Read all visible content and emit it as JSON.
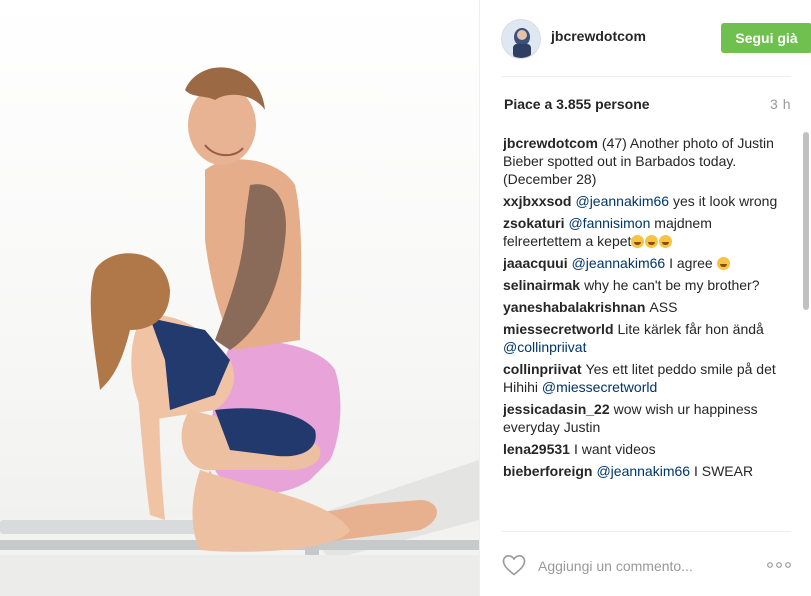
{
  "post": {
    "username": "jbcrewdotcom",
    "follow_label": "Segui già",
    "likes": "Piace a 3.855 persone",
    "time": "3 h",
    "comment_placeholder": "Aggiungi un commento...",
    "follow_color": "#70c050",
    "mention_color": "#003569"
  },
  "comments": [
    {
      "user": "jbcrewdotcom",
      "text": "(47) Another photo of Justin Bieber spotted out in Barbados today. (December 28)"
    },
    {
      "user": "xxjbxxsod",
      "mention": "@jeannakim66",
      "text": "yes it look wrong"
    },
    {
      "user": "zsokaturi",
      "mention": "@fannisimon",
      "text": "majdnem felreertettem a kepet",
      "emoji_count": 3
    },
    {
      "user": "jaaacquui",
      "mention": "@jeannakim66",
      "text": "I agree",
      "emoji_count": 1
    },
    {
      "user": "selinairmak",
      "text": "why he can't be my brother?"
    },
    {
      "user": "yaneshabalakrishnan",
      "text": "ASS"
    },
    {
      "user": "miessecretworld",
      "text": "Lite kärlek får hon ändå",
      "mention_after": "@collinpriivat"
    },
    {
      "user": "collinpriivat",
      "text": "Yes ett litet peddo smile på det Hihihi",
      "mention_after": "@miessecretworld"
    },
    {
      "user": "jessicadasin_22",
      "text": "wow wish ur happiness everyday Justin"
    },
    {
      "user": "lena29531",
      "text": "I want videos"
    },
    {
      "user": "bieberforeign",
      "mention": "@jeannakim66",
      "text": "I SWEAR"
    }
  ],
  "icons": {
    "like": "heart-icon",
    "more": "more-options-icon",
    "avatar": "avatar"
  }
}
